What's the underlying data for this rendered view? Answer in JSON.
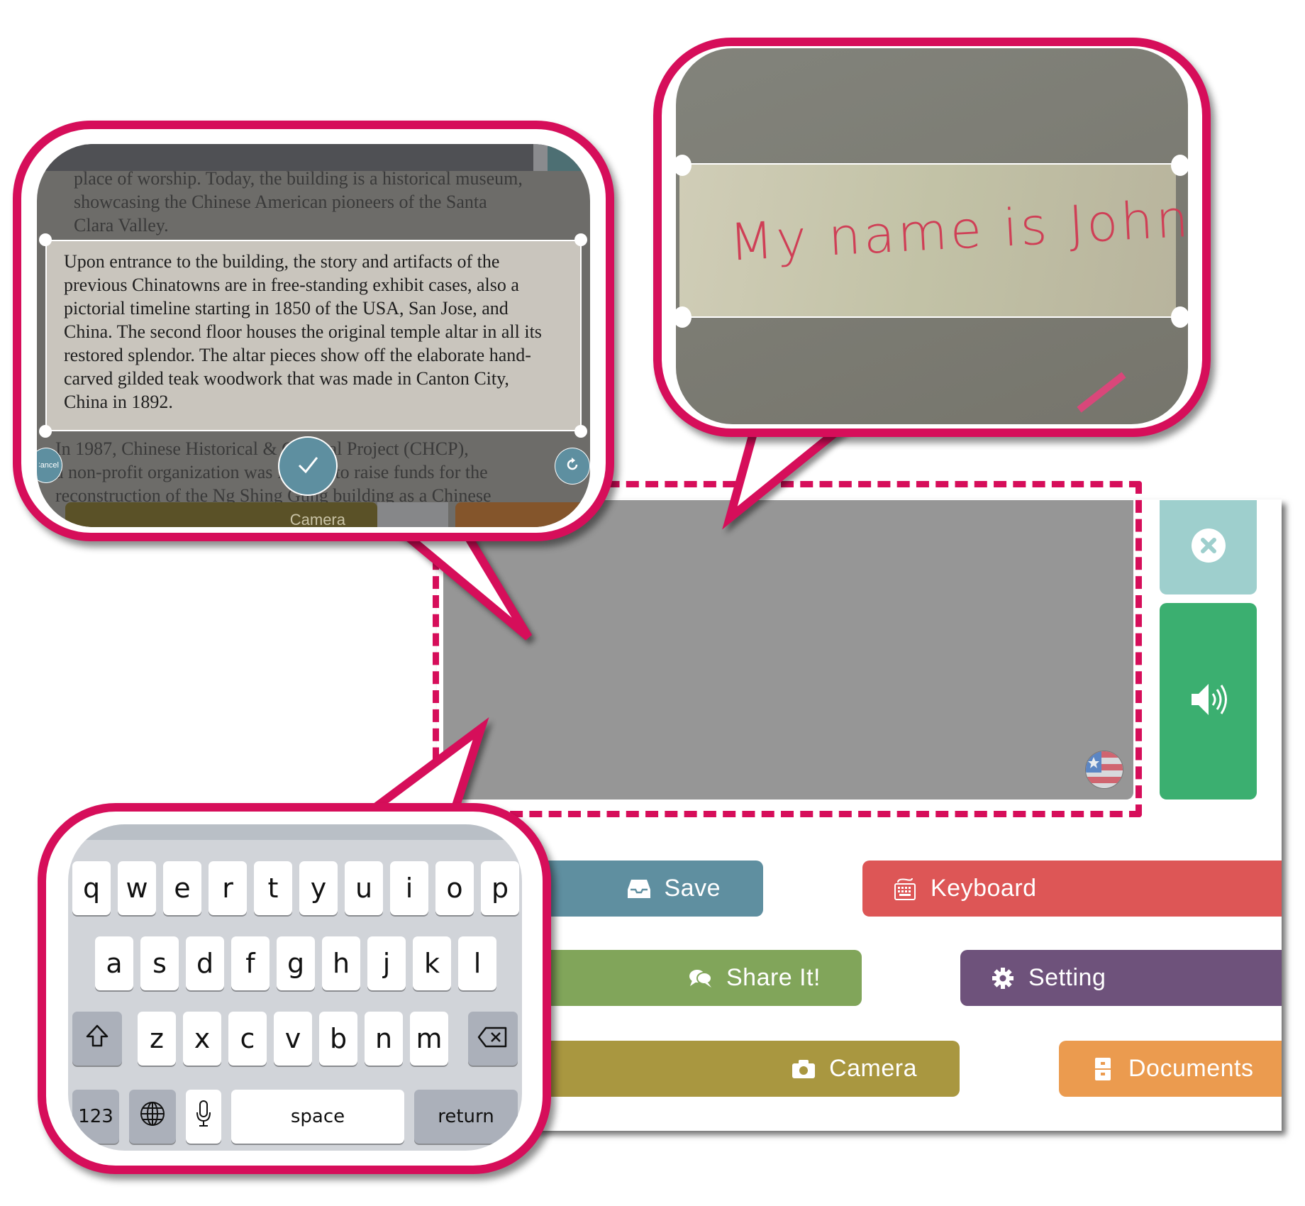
{
  "main": {
    "text_area_content": "",
    "language_flag": "us-flag-icon",
    "close_icon": "close-circle-icon",
    "speak_icon": "speaker-volume-icon"
  },
  "buttons": {
    "save": {
      "label": "Save",
      "icon": "inbox-tray-icon",
      "color": "#5f8fa0"
    },
    "keyboard": {
      "label": "Keyboard",
      "icon": "keyboard-icon",
      "color": "#dd5656"
    },
    "share": {
      "label": "Share It!",
      "icon": "chat-bubbles-icon",
      "color": "#81a55a"
    },
    "setting": {
      "label": "Setting",
      "icon": "gear-icon",
      "color": "#6e527b"
    },
    "camera": {
      "label": "Camera",
      "icon": "camera-icon",
      "color": "#a99740"
    },
    "documents": {
      "label": "Documents",
      "icon": "file-cabinet-icon",
      "color": "#eb9b4f"
    }
  },
  "callout_document_scan": {
    "above_selection": [
      "place of worship. Today, the building is a historical museum,",
      "showcasing the Chinese American pioneers of the Santa",
      "Clara Valley."
    ],
    "selection": [
      "Upon entrance to the building, the story and artifacts of the",
      "previous Chinatowns are in free-standing exhibit cases, also a",
      "pictorial timeline starting in 1850 of the USA, San Jose, and",
      "China. The second floor houses the original temple altar in all its",
      "restored splendor. The altar pieces show off the elaborate hand-",
      "carved gilded teak woodwork that was made in Canton City,",
      "China in 1892."
    ],
    "below_selection": [
      "In 1987, Chinese Historical & Cultural Project (CHCP),",
      "a non-profit organization was formed to raise funds for the",
      "reconstruction of the Ng Shing Gung building as a Chinese"
    ],
    "cancel_label": "Cancel",
    "confirm_icon": "checkmark-icon",
    "rotate_icon": "rotate-icon",
    "camera_label": "Camera"
  },
  "callout_handwriting": {
    "handwritten_text": "My  name is John."
  },
  "callout_keyboard": {
    "row1": [
      "q",
      "w",
      "e",
      "r",
      "t",
      "y",
      "u",
      "i",
      "o",
      "p"
    ],
    "row2": [
      "a",
      "s",
      "d",
      "f",
      "g",
      "h",
      "j",
      "k",
      "l"
    ],
    "row3": [
      "z",
      "x",
      "c",
      "v",
      "b",
      "n",
      "m"
    ],
    "shift_icon": "shift-icon",
    "delete_icon": "backspace-icon",
    "numbers_label": "123",
    "globe_icon": "globe-icon",
    "mic_icon": "microphone-icon",
    "space_label": "space",
    "return_label": "return"
  },
  "colors": {
    "callout_border": "#d60e5a",
    "text_area": "#969696",
    "close_button": "#9ecfcd",
    "speak_button": "#3baf70"
  }
}
